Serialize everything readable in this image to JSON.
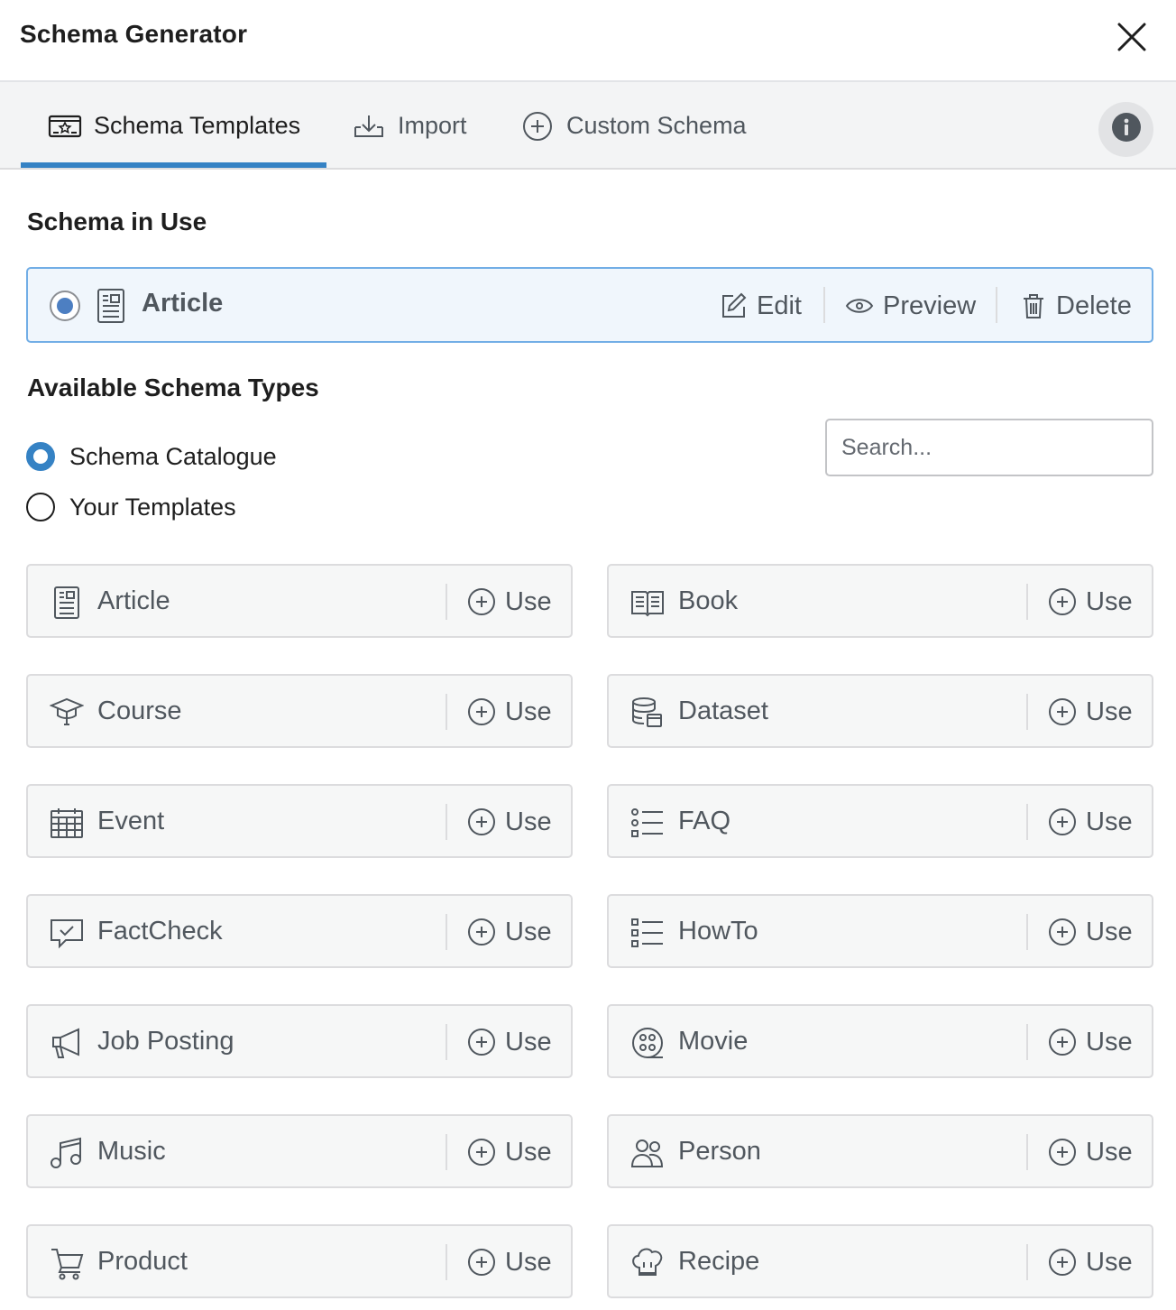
{
  "header": {
    "title": "Schema Generator"
  },
  "tabs": [
    {
      "label": "Schema Templates",
      "icon": "schema-templates-icon"
    },
    {
      "label": "Import",
      "icon": "import-icon"
    },
    {
      "label": "Custom Schema",
      "icon": "plus-circle-icon"
    }
  ],
  "in_use": {
    "title": "Schema in Use",
    "item": {
      "name": "Article",
      "icon": "article-icon",
      "selected": true
    },
    "actions": {
      "edit": "Edit",
      "preview": "Preview",
      "delete": "Delete"
    }
  },
  "available": {
    "title": "Available Schema Types",
    "options": [
      {
        "label": "Schema Catalogue",
        "selected": true
      },
      {
        "label": "Your Templates",
        "selected": false
      }
    ],
    "search_placeholder": "Search...",
    "use_label": "Use",
    "types": [
      {
        "name": "Article",
        "icon": "article-icon"
      },
      {
        "name": "Book",
        "icon": "book-icon"
      },
      {
        "name": "Course",
        "icon": "graduation-cap-icon"
      },
      {
        "name": "Dataset",
        "icon": "database-icon"
      },
      {
        "name": "Event",
        "icon": "calendar-icon"
      },
      {
        "name": "FAQ",
        "icon": "list-icon"
      },
      {
        "name": "FactCheck",
        "icon": "factcheck-icon"
      },
      {
        "name": "HowTo",
        "icon": "checklist-icon"
      },
      {
        "name": "Job Posting",
        "icon": "megaphone-icon"
      },
      {
        "name": "Movie",
        "icon": "film-reel-icon"
      },
      {
        "name": "Music",
        "icon": "music-note-icon"
      },
      {
        "name": "Person",
        "icon": "people-icon"
      },
      {
        "name": "Product",
        "icon": "cart-icon"
      },
      {
        "name": "Recipe",
        "icon": "chef-hat-icon"
      }
    ]
  },
  "colors": {
    "accent": "#3582c4",
    "selected_border": "#72aee6",
    "selected_bg": "#f0f6fc",
    "card_bg": "#f6f7f7"
  }
}
